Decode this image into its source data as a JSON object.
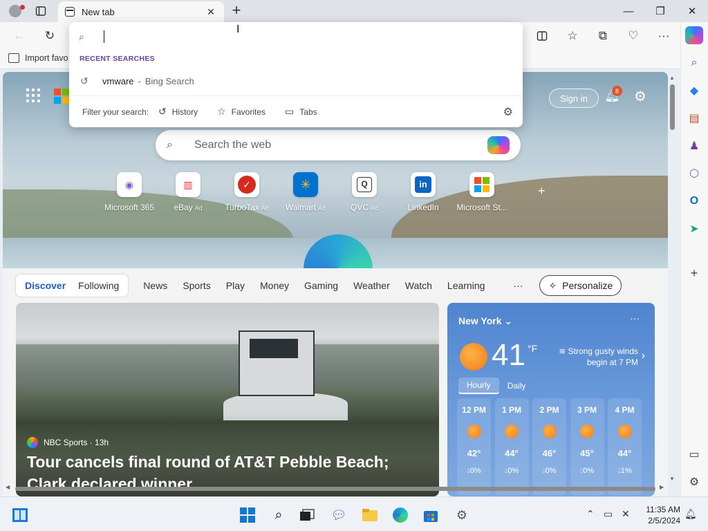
{
  "browser": {
    "tab_title": "New tab",
    "favorites_bar_item": "Import favo"
  },
  "address_dropdown": {
    "recent_heading": "RECENT SEARCHES",
    "recent_query": "vmware",
    "recent_separator": "-",
    "recent_source": "Bing Search",
    "filter_label": "Filter your search:",
    "filters": [
      "History",
      "Favorites",
      "Tabs"
    ]
  },
  "header": {
    "signin_label": "Sign in",
    "notifications_count": "8"
  },
  "search": {
    "placeholder": "Search the web"
  },
  "quick_links": [
    {
      "label": "Microsoft 365",
      "ad": ""
    },
    {
      "label": "eBay",
      "ad": "Ad"
    },
    {
      "label": "TurboTax",
      "ad": "Ad"
    },
    {
      "label": "Walmart",
      "ad": "Ad"
    },
    {
      "label": "QVC",
      "ad": "Ad"
    },
    {
      "label": "LinkedIn",
      "ad": ""
    },
    {
      "label": "Microsoft St...",
      "ad": ""
    }
  ],
  "feed_nav": {
    "primary": [
      "Discover",
      "Following"
    ],
    "items": [
      "News",
      "Sports",
      "Play",
      "Money",
      "Gaming",
      "Weather",
      "Watch",
      "Learning"
    ],
    "more": "···",
    "personalize": "Personalize"
  },
  "article": {
    "source": "NBC Sports · 13h",
    "headline": "Tour cancels final round of AT&T Pebble Beach; Clark declared winner"
  },
  "weather": {
    "city": "New York",
    "temp": "41",
    "unit": "°F",
    "alert": "Strong gusty winds begin at 7 PM",
    "tabs": [
      "Hourly",
      "Daily"
    ],
    "hours": [
      {
        "time": "12 PM",
        "temp": "42°",
        "precip": "0%"
      },
      {
        "time": "1 PM",
        "temp": "44°",
        "precip": "0%"
      },
      {
        "time": "2 PM",
        "temp": "46°",
        "precip": "0%"
      },
      {
        "time": "3 PM",
        "temp": "45°",
        "precip": "0%"
      },
      {
        "time": "4 PM",
        "temp": "44°",
        "precip": "1%"
      }
    ]
  },
  "taskbar": {
    "time": "11:35 AM",
    "date": "2/5/2024"
  }
}
